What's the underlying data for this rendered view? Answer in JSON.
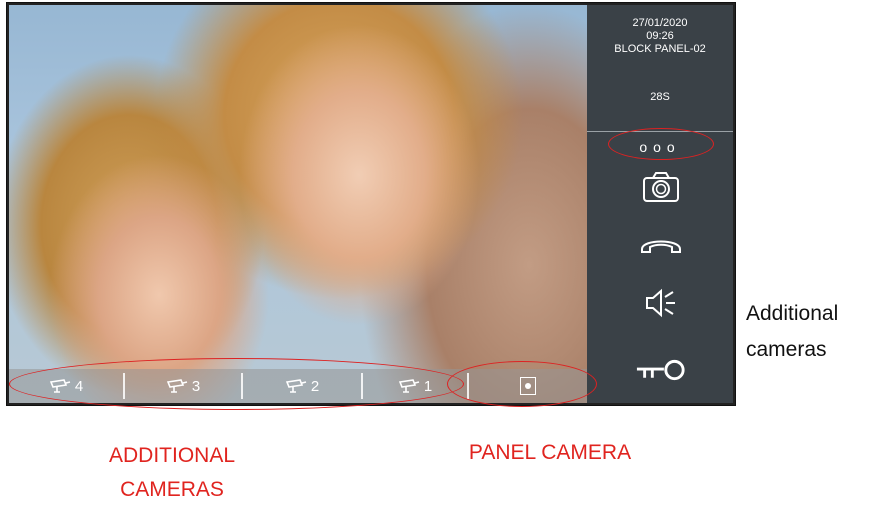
{
  "screen": {
    "date": "27/01/2020",
    "time": "09:26",
    "panel_name": "BLOCK PANEL-02",
    "timer": "28S",
    "more_label": "ooo"
  },
  "camera_bar": {
    "cameras": [
      {
        "label": "4",
        "icon": "cctv-camera-icon"
      },
      {
        "label": "3",
        "icon": "cctv-camera-icon"
      },
      {
        "label": "2",
        "icon": "cctv-camera-icon"
      },
      {
        "label": "1",
        "icon": "cctv-camera-icon"
      }
    ],
    "panel_camera_icon": "door-panel-icon"
  },
  "side_buttons": [
    "camera-snapshot-icon",
    "hang-up-icon",
    "speaker-icon",
    "door-key-icon"
  ],
  "annotations": {
    "additional_cameras": "ADDITIONAL CAMERAS",
    "panel_camera": "PANEL CAMERA",
    "side_note_line1": "Additional",
    "side_note_line2": "cameras"
  },
  "colors": {
    "annotation_red": "#e0241f",
    "side_panel": "#3a4147"
  }
}
